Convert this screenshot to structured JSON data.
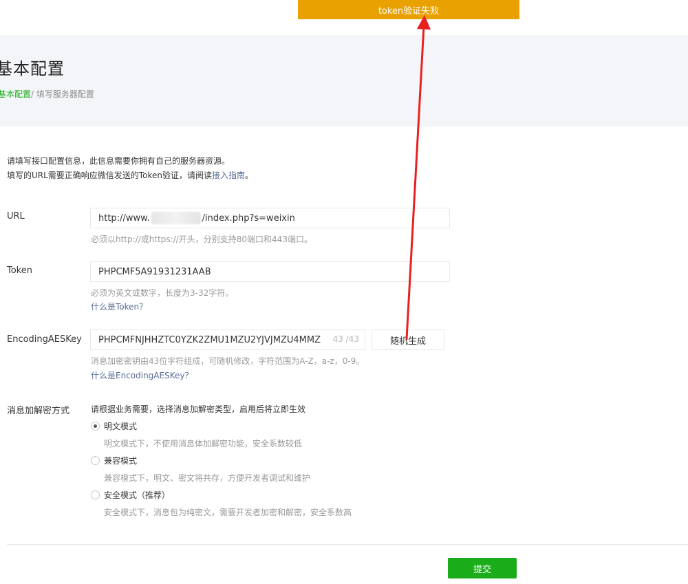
{
  "toast": {
    "message": "token验证失败"
  },
  "header": {
    "title": "基本配置",
    "breadcrumb_link": "基本配置",
    "breadcrumb_sep": "/ ",
    "breadcrumb_current": "填写服务器配置"
  },
  "intro": {
    "line1": "请填写接口配置信息，此信息需要你拥有自己的服务器资源。",
    "line2_prefix": "填写的URL需要正确响应微信发送的Token验证，请阅读",
    "line2_link": "接入指南",
    "line2_suffix": "。"
  },
  "url": {
    "label": "URL",
    "value_prefix": "http://www.",
    "value_suffix": "/index.php?s=weixin",
    "hint": "必须以http://或https://开头，分别支持80端口和443端口。"
  },
  "token": {
    "label": "Token",
    "value": "PHPCMF5A91931231AAB",
    "hint": "必须为英文或数字，长度为3-32字符。",
    "help_link": "什么是Token？"
  },
  "aeskey": {
    "label": "EncodingAESKey",
    "value": "PHPCMFNJHHZTC0YZK2ZMU1MZU2YJVJMZU4MMZ",
    "counter": "43 /43",
    "generate_label": "随机生成",
    "hint": "消息加密密钥由43位字符组成，可随机修改，字符范围为A-Z，a-z，0-9。",
    "help_link": "什么是EncodingAESKey？"
  },
  "encryption": {
    "label": "消息加解密方式",
    "intro": "请根据业务需要，选择消息加解密类型，启用后将立即生效",
    "options": [
      {
        "label": "明文模式",
        "desc": "明文模式下，不使用消息体加解密功能，安全系数较低",
        "checked": true
      },
      {
        "label": "兼容模式",
        "desc": "兼容模式下，明文、密文将共存，方便开发者调试和维护",
        "checked": false
      },
      {
        "label": "安全模式（推荐）",
        "desc": "安全模式下，消息包为纯密文，需要开发者加密和解密，安全系数高",
        "checked": false
      }
    ]
  },
  "footer": {
    "submit_label": "提交"
  },
  "colors": {
    "toast": "#e8a100",
    "accent": "#1aad19",
    "link": "#576b95",
    "arrow": "#e8201f"
  }
}
